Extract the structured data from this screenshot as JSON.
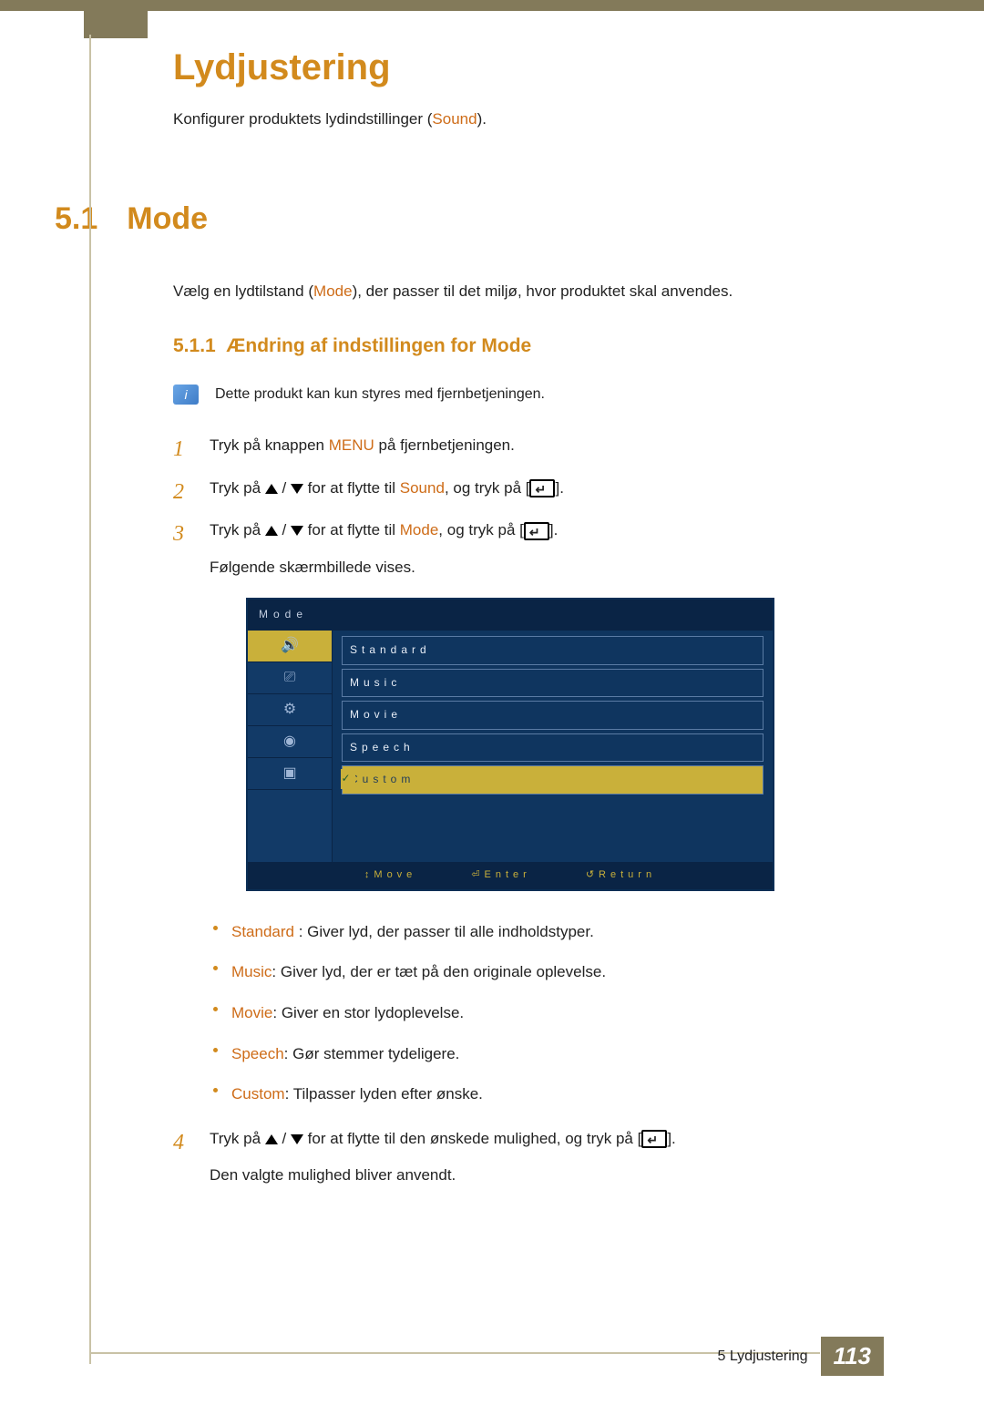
{
  "header": {
    "title": "Lydjustering",
    "intro_pre": "Konfigurer produktets lydindstillinger (",
    "intro_kw": "Sound",
    "intro_post": ")."
  },
  "section": {
    "num": "5.1",
    "title": "Mode",
    "lead_pre": "Vælg en lydtilstand (",
    "lead_kw": "Mode",
    "lead_post": "), der passer til det miljø, hvor produktet skal anvendes."
  },
  "sub": {
    "num": "5.1.1",
    "title": "Ændring af indstillingen for Mode"
  },
  "note": "Dette produkt kan kun styres med fjernbetjeningen.",
  "steps": {
    "s1_pre": "Tryk på knappen ",
    "s1_kw": "MENU",
    "s1_post": " på fjernbetjeningen.",
    "s2_pre": "Tryk på ",
    "s2_mid": " for at flytte til ",
    "s2_kw": "Sound",
    "s2_post": ", og tryk på [",
    "s2_end": "].",
    "s3_pre": "Tryk på ",
    "s3_mid": " for at flytte til ",
    "s3_kw": "Mode",
    "s3_post": ", og tryk på [",
    "s3_end": "].",
    "s3_after": "Følgende skærmbillede vises.",
    "s4_pre": "Tryk på ",
    "s4_mid": " for at flytte til den ønskede mulighed, og tryk på [",
    "s4_end": "].",
    "s4_after": "Den valgte mulighed bliver anvendt."
  },
  "osd": {
    "title": "Mode",
    "options": [
      "Standard",
      "Music",
      "Movie",
      "Speech",
      "Custom"
    ],
    "selected_index": 4,
    "footer": {
      "move": "Move",
      "enter": "Enter",
      "return": "Return"
    }
  },
  "descs": [
    {
      "kw": "Standard",
      "sep": " : ",
      "txt": "Giver lyd, der passer til alle indholdstyper."
    },
    {
      "kw": "Music",
      "sep": ": ",
      "txt": "Giver lyd, der er tæt på den originale oplevelse."
    },
    {
      "kw": "Movie",
      "sep": ": ",
      "txt": "Giver en stor lydoplevelse."
    },
    {
      "kw": "Speech",
      "sep": ": ",
      "txt": "Gør stemmer tydeligere."
    },
    {
      "kw": "Custom",
      "sep": ": ",
      "txt": "Tilpasser lyden efter ønske."
    }
  ],
  "footer": {
    "chapter": "5 Lydjustering",
    "page": "113"
  }
}
